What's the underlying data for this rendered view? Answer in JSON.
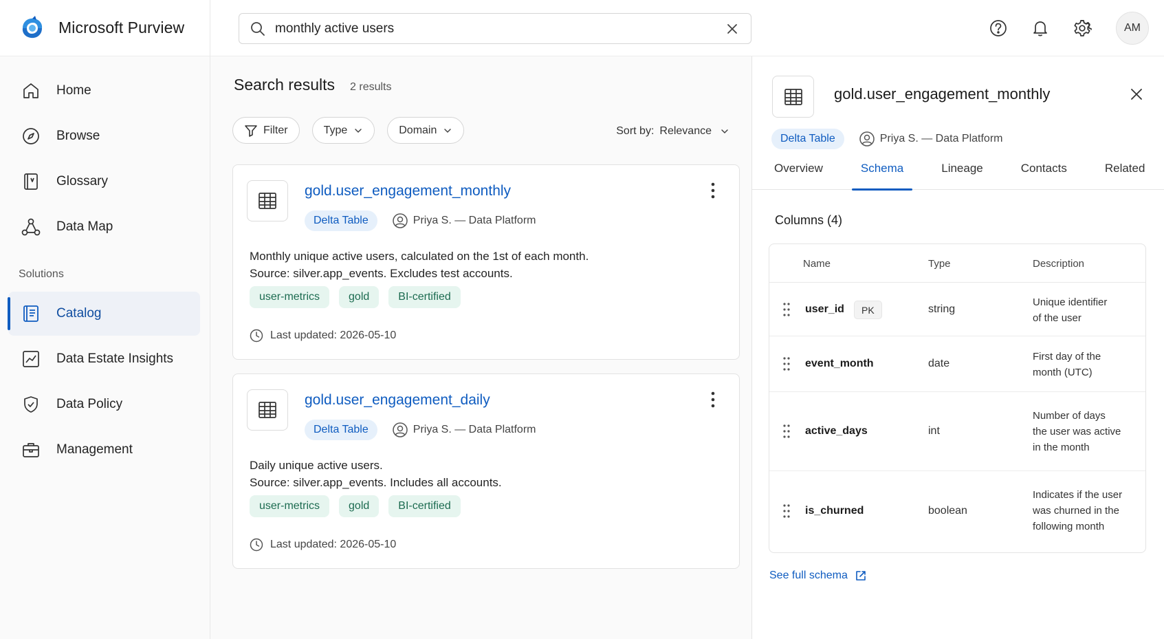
{
  "app": {
    "name": "Microsoft Purview"
  },
  "search": {
    "value": "monthly active users",
    "placeholder": "Search"
  },
  "header": {
    "avatar_initials": "AM"
  },
  "sidebar": {
    "items": [
      {
        "label": "Home",
        "icon": "home-icon"
      },
      {
        "label": "Browse",
        "icon": "compass-icon"
      },
      {
        "label": "Glossary",
        "icon": "book-icon"
      },
      {
        "label": "Data Map",
        "icon": "data-map-icon"
      }
    ],
    "section_label": "Solutions",
    "solutions": [
      {
        "label": "Catalog",
        "icon": "catalog-icon",
        "active": true
      },
      {
        "label": "Data Estate Insights",
        "icon": "insights-chart-icon"
      },
      {
        "label": "Data Policy",
        "icon": "shield-icon"
      },
      {
        "label": "Management",
        "icon": "briefcase-icon"
      }
    ]
  },
  "results": {
    "title": "Search results",
    "count": "2 results",
    "filters": {
      "filter": "Filter",
      "type": "Type",
      "domain": "Domain"
    },
    "sort": {
      "label": "Sort by:",
      "value": "Relevance"
    },
    "cards": [
      {
        "title": "gold.user_engagement_monthly",
        "badge": "Delta Table",
        "owner": "Priya S. — Data Platform",
        "desc1": "Monthly unique active users, calculated on the 1st of each month.",
        "desc2": "Source: silver.app_events. Excludes test accounts.",
        "tags": [
          "user-metrics",
          "gold",
          "BI-certified"
        ],
        "updated": "Last updated: 2026-05-10"
      },
      {
        "title": "gold.user_engagement_daily",
        "badge": "Delta Table",
        "owner": "Priya S. — Data Platform",
        "desc1": "Daily unique active users.",
        "desc2": "Source: silver.app_events. Includes all accounts.",
        "tags": [
          "user-metrics",
          "gold",
          "BI-certified"
        ],
        "updated": "Last updated: 2026-05-10"
      }
    ]
  },
  "details": {
    "title": "gold.user_engagement_monthly",
    "badge": "Delta Table",
    "owner": "Priya S. — Data Platform",
    "tabs": [
      "Overview",
      "Schema",
      "Lineage",
      "Contacts",
      "Related"
    ],
    "active_tab": "Schema",
    "columns_title": "Columns (4)",
    "headers": {
      "name": "Name",
      "type": "Type",
      "description": "Description"
    },
    "columns": [
      {
        "name": "user_id",
        "badge": "PK",
        "type": "string",
        "desc_lines": [
          "Unique identifier",
          "of the user"
        ]
      },
      {
        "name": "event_month",
        "type": "date",
        "desc_lines": [
          "First day of the",
          "month (UTC)"
        ]
      },
      {
        "name": "active_days",
        "type": "int",
        "desc_lines": [
          "Number of days",
          "the user was active",
          "in the month"
        ]
      },
      {
        "name": "is_churned",
        "type": "boolean",
        "desc_lines": [
          "Indicates if the user",
          "was churned in the",
          "following month"
        ]
      }
    ],
    "see_full": "See full schema"
  },
  "colors": {
    "accent": "#0f5cc0",
    "badge_bg": "#e6f0fb",
    "tag_bg": "#e6f5ef",
    "tag_text": "#1c6b50"
  }
}
